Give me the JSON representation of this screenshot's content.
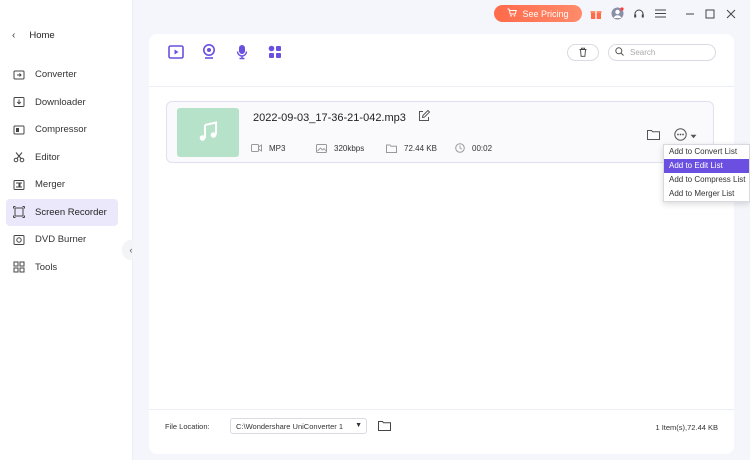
{
  "titlebar": {
    "pricing_label": "See Pricing",
    "accent": "#ff6a4a"
  },
  "sidebar": {
    "home_label": "Home",
    "items": [
      {
        "label": "Converter",
        "icon": "converter-icon"
      },
      {
        "label": "Downloader",
        "icon": "downloader-icon"
      },
      {
        "label": "Compressor",
        "icon": "compressor-icon"
      },
      {
        "label": "Editor",
        "icon": "scissors-icon"
      },
      {
        "label": "Merger",
        "icon": "merger-icon"
      },
      {
        "label": "Screen Recorder",
        "icon": "screen-recorder-icon",
        "active": true
      },
      {
        "label": "DVD Burner",
        "icon": "disc-icon"
      },
      {
        "label": "Tools",
        "icon": "tools-grid-icon"
      }
    ]
  },
  "toolbar": {
    "tools": [
      "record-screen-icon",
      "webcam-icon",
      "audio-recorder-icon",
      "apps-grid-icon"
    ],
    "search_placeholder": "Search"
  },
  "file": {
    "name": "2022-09-03_17-36-21-042.mp3",
    "format": "MP3",
    "bitrate": "320kbps",
    "size": "72.44 KB",
    "duration": "00:02"
  },
  "dropdown": {
    "items": [
      "Add to Convert List",
      "Add to Edit List",
      "Add to Compress List",
      "Add to Merger List"
    ],
    "selected_index": 1,
    "selected_color": "#6b4fe0"
  },
  "footer": {
    "location_label": "File Location:",
    "path": "C:\\Wondershare UniConverter 1",
    "count_text": "1 Item(s),72.44 KB"
  }
}
